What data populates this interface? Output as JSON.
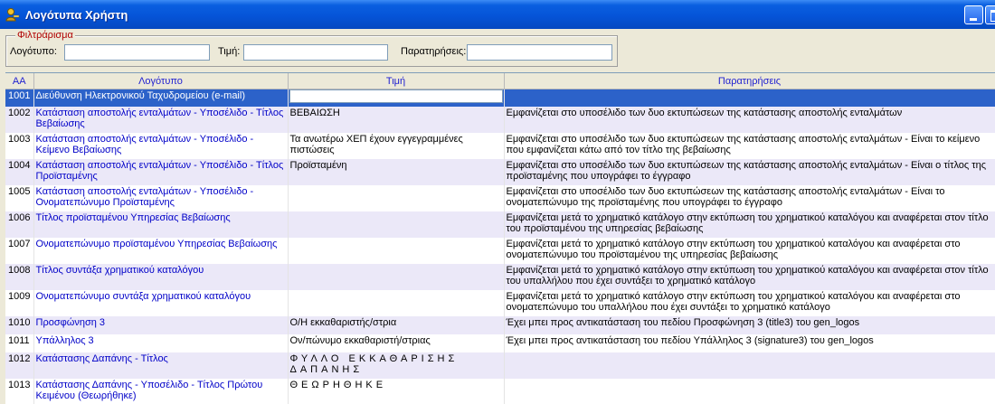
{
  "window": {
    "title": "Λογότυπα Χρήστη"
  },
  "filter": {
    "legend": "Φιλτράρισμα",
    "logo_label": "Λογότυπο:",
    "value_label": "Τιμή:",
    "notes_label": "Παρατηρήσεις:",
    "logo_value": "",
    "value_value": "",
    "notes_value": ""
  },
  "table": {
    "headers": [
      "ΑΑ",
      "Λογότυπο",
      "Τιμή",
      "Παρατηρήσεις"
    ],
    "rows": [
      {
        "aa": "1001",
        "logo": "Διεύθυνση Ηλεκτρονικού Ταχυδρομείου (e-mail)",
        "value": "",
        "notes": ""
      },
      {
        "aa": "1002",
        "logo": "Κατάσταση αποστολής ενταλμάτων - Υποσέλιδο - Τίτλος Βεβαίωσης",
        "value": "ΒΕΒΑΙΩΣΗ",
        "notes": "Εμφανίζεται στο υποσέλιδο των δυο εκτυπώσεων της κατάστασης αποστολής ενταλμάτων"
      },
      {
        "aa": "1003",
        "logo": "Κατάσταση αποστολής ενταλμάτων - Υποσέλιδο - Κείμενο Βεβαίωσης",
        "value": "Τα ανωτέρω ΧΕΠ έχουν εγγεγραμμένες πιστώσεις",
        "notes": "Εμφανίζεται στο υποσέλιδο των δυο εκτυπώσεων της κατάστασης αποστολής ενταλμάτων - Είναι το κείμενο που εμφανίζεται κάτω από τον τίτλο της βεβαίωσης"
      },
      {
        "aa": "1004",
        "logo": "Κατάσταση αποστολής ενταλμάτων - Υποσέλιδο - Τίτλος Προϊσταμένης",
        "value": "Προϊσταμένη",
        "notes": "Εμφανίζεται στο υποσέλιδο των δυο εκτυπώσεων της κατάστασης αποστολής ενταλμάτων - Είναι ο τίτλος της προϊσταμένης που υπογράφει το έγγραφο"
      },
      {
        "aa": "1005",
        "logo": "Κατάσταση αποστολής ενταλμάτων - Υποσέλιδο - Ονοματεπώνυμο Προϊσταμένης",
        "value": "",
        "notes": "Εμφανίζεται στο υποσέλιδο των δυο εκτυπώσεων της κατάστασης αποστολής ενταλμάτων - Είναι το ονοματεπώνυμο της προϊσταμένης που υπογράφει το έγγραφο"
      },
      {
        "aa": "1006",
        "logo": "Τίτλος προϊσταμένου Υπηρεσίας Βεβαίωσης",
        "value": "",
        "notes": "Εμφανίζεται μετά το χρηματικό κατάλογο στην εκτύπωση του χρηματικού καταλόγου και αναφέρεται στον τίτλο του προϊσταμένου της υπηρεσίας βεβαίωσης"
      },
      {
        "aa": "1007",
        "logo": "Ονοματεπώνυμο προϊσταμένου Υπηρεσίας Βεβαίωσης",
        "value": "",
        "notes": "Εμφανίζεται μετά το χρηματικό κατάλογο στην εκτύπωση του χρηματικού καταλόγου και αναφέρεται στο ονοματεπώνυμο του προϊσταμένου της υπηρεσίας βεβαίωσης"
      },
      {
        "aa": "1008",
        "logo": "Τίτλος συντάξα χρηματικού καταλόγου",
        "value": "",
        "notes": "Εμφανίζεται μετά το χρηματικό κατάλογο στην εκτύπωση του χρηματικού καταλόγου και αναφέρεται στον τίτλο του υπαλλήλου που έχει συντάξει το χρηματικό κατάλογο"
      },
      {
        "aa": "1009",
        "logo": "Ονοματεπώνυμο συντάξα χρηματικού καταλόγου",
        "value": "",
        "notes": "Εμφανίζεται μετά το χρηματικό κατάλογο στην εκτύπωση του χρηματικού καταλόγου και αναφέρεται στο ονοματεπώνυμο του υπαλλήλου που έχει συντάξει το χρηματικό κατάλογο"
      },
      {
        "aa": "1010",
        "logo": "Προσφώνηση 3",
        "value": "Ο/Η εκκαθαριστής/στρια",
        "notes": "Έχει μπει προς αντικατάσταση του πεδίου Προσφώνηση 3 (title3) του gen_logos"
      },
      {
        "aa": "1011",
        "logo": "Υπάλληλος 3",
        "value": "Ον/πώνυμο εκκαθαριστή/στριας",
        "notes": "Έχει μπει προς αντικατάσταση του πεδίου Υπάλληλος 3 (signature3) του gen_logos"
      },
      {
        "aa": "1012",
        "logo": "Κατάστασης Δαπάνης - Τίτλος",
        "value": "ΦΥΛΛΟ ΕΚΚΑΘΑΡΙΣΗΣ ΔΑΠΑΝΗΣ",
        "notes": ""
      },
      {
        "aa": "1013",
        "logo": "Κατάστασης Δαπάνης - Υποσέλιδο - Τίτλος Πρώτου Κειμένου (Θεωρήθηκε)",
        "value": "ΘΕΩΡΗΘΗΚΕ",
        "notes": ""
      }
    ]
  },
  "colors": {
    "titlebar": "#0554d8",
    "selected_row": "#2c62c9",
    "link_text": "#0000c8",
    "alt_row": "#ebe8f8",
    "legend": "#b00000"
  },
  "icons": {
    "app": "user-key-icon",
    "minimize": "minimize-icon",
    "maximize": "maximize-icon"
  }
}
